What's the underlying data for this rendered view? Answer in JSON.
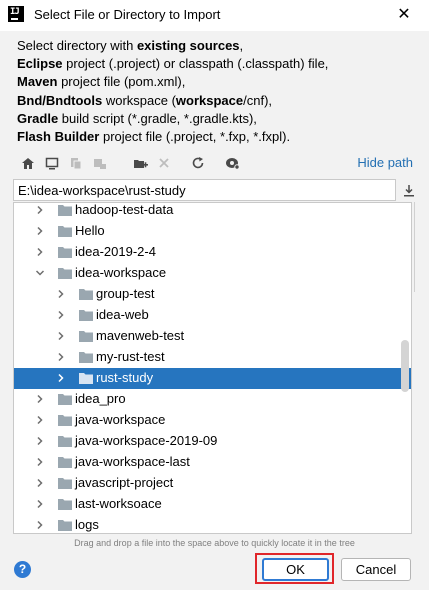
{
  "window": {
    "title": "Select File or Directory to Import",
    "app_icon": "intellij-icon",
    "close_label": "✕"
  },
  "description": {
    "line1_pre": "Select directory with ",
    "line1_bold": "existing sources",
    "line1_post": ",",
    "line2_bold": "Eclipse",
    "line2_rest": " project (.project) or classpath (.classpath) file,",
    "line3_bold": "Maven",
    "line3_rest": " project file (pom.xml),",
    "line4_bold": "Bnd/Bndtools",
    "line4_mid": " workspace (",
    "line4_bold2": "workspace",
    "line4_rest": "/cnf),",
    "line5_bold": "Gradle",
    "line5_rest": " build script (*.gradle, *.gradle.kts),",
    "line6_bold": "Flash Builder",
    "line6_rest": " project file (.project, *.fxp, *.fxpl)."
  },
  "toolbar": {
    "icons": [
      "home-icon",
      "desktop-icon",
      "project-icon",
      "module-icon",
      "new-folder-icon",
      "delete-icon",
      "refresh-icon",
      "show-hidden-icon"
    ],
    "hide_path_label": "Hide path"
  },
  "path": {
    "value": "E:\\idea-workspace\\rust-study",
    "download_icon": "download-icon"
  },
  "tree": {
    "items": [
      {
        "label": "hadoop-test-data",
        "level": 1,
        "expanded": false,
        "selected": false
      },
      {
        "label": "Hello",
        "level": 1,
        "expanded": false,
        "selected": false
      },
      {
        "label": "idea-2019-2-4",
        "level": 1,
        "expanded": false,
        "selected": false
      },
      {
        "label": "idea-workspace",
        "level": 1,
        "expanded": true,
        "selected": false
      },
      {
        "label": "group-test",
        "level": 2,
        "expanded": false,
        "selected": false
      },
      {
        "label": "idea-web",
        "level": 2,
        "expanded": false,
        "selected": false
      },
      {
        "label": "mavenweb-test",
        "level": 2,
        "expanded": false,
        "selected": false
      },
      {
        "label": "my-rust-test",
        "level": 2,
        "expanded": false,
        "selected": false
      },
      {
        "label": "rust-study",
        "level": 2,
        "expanded": false,
        "selected": true
      },
      {
        "label": "idea_pro",
        "level": 1,
        "expanded": false,
        "selected": false
      },
      {
        "label": "java-workspace",
        "level": 1,
        "expanded": false,
        "selected": false
      },
      {
        "label": "java-workspace-2019-09",
        "level": 1,
        "expanded": false,
        "selected": false
      },
      {
        "label": "java-workspace-last",
        "level": 1,
        "expanded": false,
        "selected": false
      },
      {
        "label": "javascript-project",
        "level": 1,
        "expanded": false,
        "selected": false
      },
      {
        "label": "last-worksoace",
        "level": 1,
        "expanded": false,
        "selected": false
      },
      {
        "label": "logs",
        "level": 1,
        "expanded": false,
        "selected": false
      }
    ]
  },
  "hint": "Drag and drop a file into the space above to quickly locate it in the tree",
  "buttons": {
    "help_label": "?",
    "ok_label": "OK",
    "cancel_label": "Cancel"
  },
  "colors": {
    "selection": "#2675bf",
    "link": "#2470b3",
    "highlight_border": "#e0262a",
    "focus_border": "#2f7ad3"
  }
}
